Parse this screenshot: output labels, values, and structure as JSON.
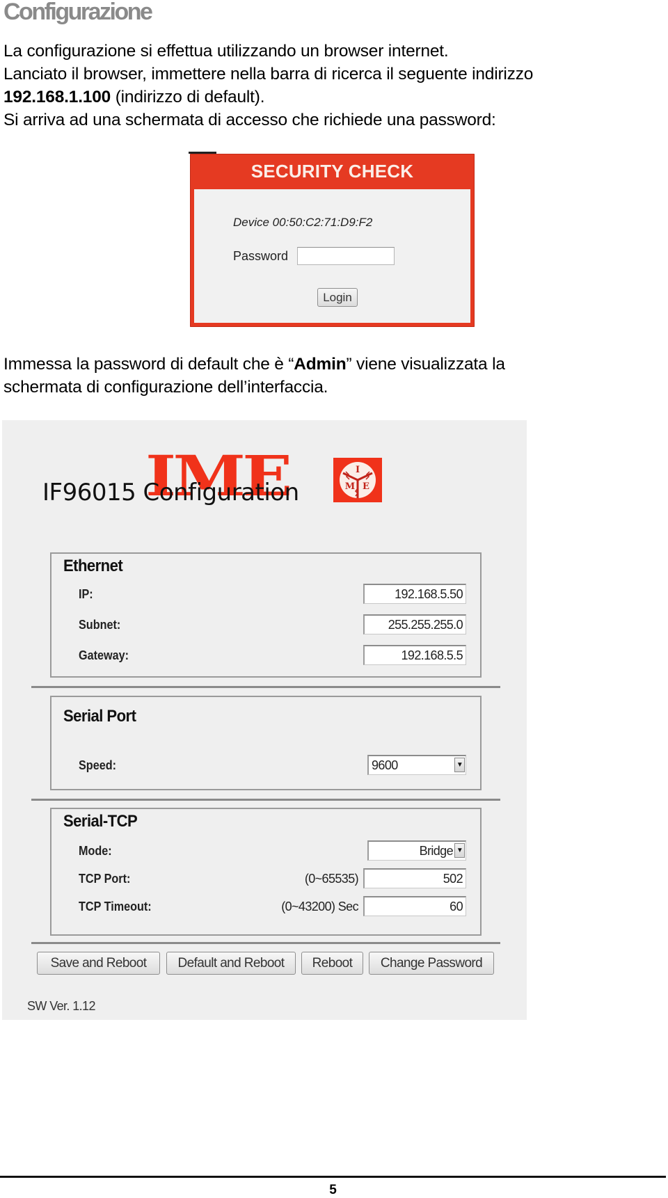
{
  "document": {
    "title": "Configurazione",
    "intro_lines": [
      "La configurazione si effettua utilizzando un browser internet.",
      "Lanciato il browser, immettere nella barra di ricerca il seguente indirizzo",
      "(indirizzo di default).",
      "Si arriva ad una schermata di accesso che richiede una password:"
    ],
    "default_ip": "192.168.1.100",
    "after_login": {
      "before": "Immessa la password di default che è “",
      "password": "Admin",
      "after": "” viene visualizzata la",
      "line2": "schermata di configurazione dell’interfaccia."
    },
    "page_number": "5"
  },
  "security_check": {
    "header": "SECURITY CHECK",
    "device_label": "Device 00:50:C2:71:D9:F2",
    "password_label": "Password",
    "password_value": "",
    "login_button": "Login",
    "accent_color": "#e53a22"
  },
  "config": {
    "logo_text": "IME",
    "logo_mark_letters": [
      "I",
      "M",
      "E"
    ],
    "title": "IF96015 Configuration",
    "brand_color": "#f0321a",
    "ethernet": {
      "legend": "Ethernet",
      "ip_label": "IP:",
      "ip_value": "192.168.5.50",
      "subnet_label": "Subnet:",
      "subnet_value": "255.255.255.0",
      "gateway_label": "Gateway:",
      "gateway_value": "192.168.5.5"
    },
    "serial_port": {
      "legend": "Serial Port",
      "speed_label": "Speed:",
      "speed_value": "9600"
    },
    "serial_tcp": {
      "legend": "Serial-TCP",
      "mode_label": "Mode:",
      "mode_value": "Bridge",
      "tcp_port_label": "TCP Port:",
      "tcp_port_hint": "(0~65535)",
      "tcp_port_value": "502",
      "tcp_timeout_label": "TCP Timeout:",
      "tcp_timeout_hint": "(0~43200) Sec",
      "tcp_timeout_value": "60"
    },
    "buttons": {
      "save_reboot": "Save and Reboot",
      "default_reboot": "Default and Reboot",
      "reboot": "Reboot",
      "change_password": "Change Password"
    },
    "sw_version": "SW Ver. 1.12"
  }
}
